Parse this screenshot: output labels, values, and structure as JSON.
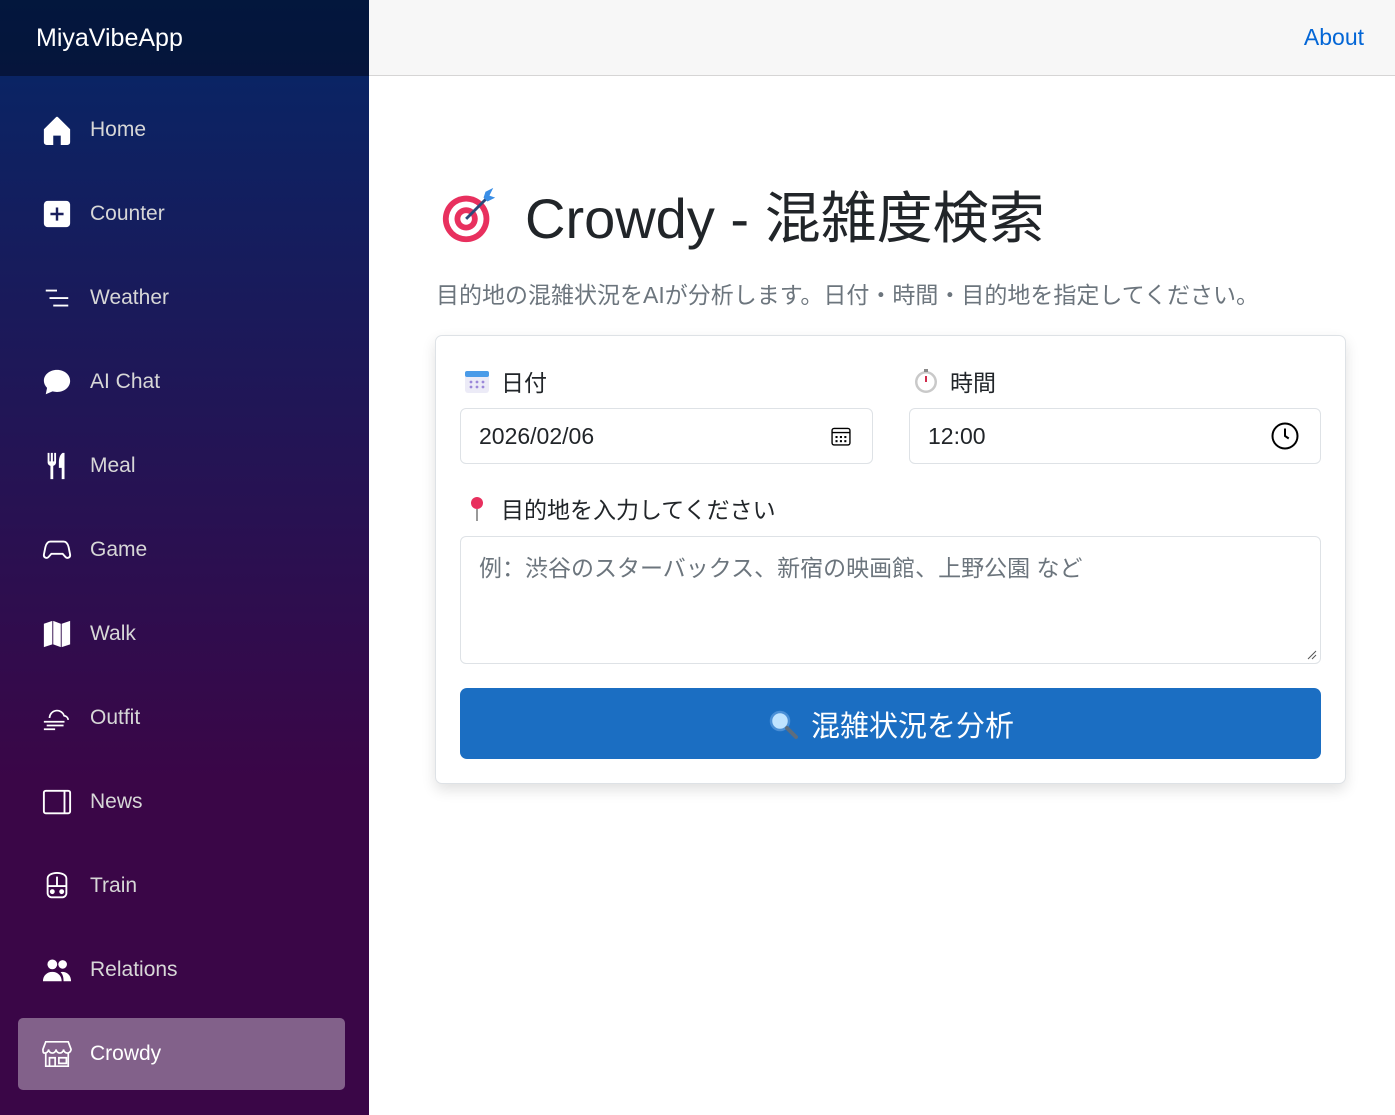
{
  "app": {
    "brand": "MiyaVibeApp"
  },
  "topbar": {
    "about": "About"
  },
  "sidebar": {
    "items": [
      {
        "label": "Home",
        "icon": "home-icon"
      },
      {
        "label": "Counter",
        "icon": "plus-square-icon"
      },
      {
        "label": "Weather",
        "icon": "list-nested-icon"
      },
      {
        "label": "AI Chat",
        "icon": "chat-bubble-icon"
      },
      {
        "label": "Meal",
        "icon": "fork-knife-icon"
      },
      {
        "label": "Game",
        "icon": "controller-icon"
      },
      {
        "label": "Walk",
        "icon": "map-icon"
      },
      {
        "label": "Outfit",
        "icon": "cloud-wind-icon"
      },
      {
        "label": "News",
        "icon": "window-icon"
      },
      {
        "label": "Train",
        "icon": "train-icon"
      },
      {
        "label": "Relations",
        "icon": "people-icon"
      },
      {
        "label": "Crowdy",
        "icon": "shop-icon",
        "active": true
      }
    ]
  },
  "page": {
    "title": "Crowdy - 混雑度検索",
    "subtitle": "目的地の混雑状況をAIが分析します。日付・時間・目的地を指定してください。"
  },
  "form": {
    "date_label": "日付",
    "date_value": "2026/02/06",
    "time_label": "時間",
    "time_value": "12:00",
    "destination_label": "目的地を入力してください",
    "destination_placeholder": "例：渋谷のスターバックス、新宿の映画館、上野公園 など",
    "submit_label": "混雑状況を分析"
  },
  "colors": {
    "sidebar_top": "#052767",
    "sidebar_bottom": "#3a0647",
    "primary": "#1b6ec2",
    "link": "#0366d6"
  }
}
